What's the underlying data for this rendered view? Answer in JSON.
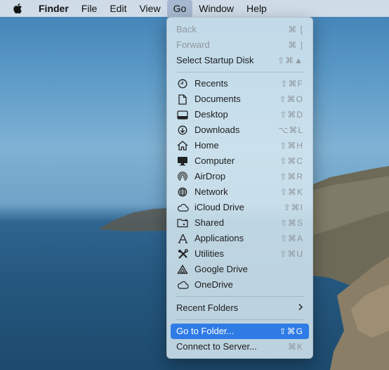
{
  "menubar": {
    "apple_icon": "apple-logo-icon",
    "items": [
      {
        "label": "Finder",
        "bold": true
      },
      {
        "label": "File"
      },
      {
        "label": "Edit"
      },
      {
        "label": "View"
      },
      {
        "label": "Go",
        "active": true
      },
      {
        "label": "Window"
      },
      {
        "label": "Help"
      }
    ]
  },
  "go_menu": {
    "section1": [
      {
        "label": "Back",
        "shortcut": "⌘ [",
        "disabled": true
      },
      {
        "label": "Forward",
        "shortcut": "⌘ ]",
        "disabled": true
      },
      {
        "label": "Select Startup Disk",
        "shortcut": "⇧⌘▲"
      }
    ],
    "section2": [
      {
        "label": "Recents",
        "shortcut": "⇧⌘F",
        "icon": "clock-icon"
      },
      {
        "label": "Documents",
        "shortcut": "⇧⌘O",
        "icon": "document-icon"
      },
      {
        "label": "Desktop",
        "shortcut": "⇧⌘D",
        "icon": "desktop-icon"
      },
      {
        "label": "Downloads",
        "shortcut": "⌥⌘L",
        "icon": "download-icon"
      },
      {
        "label": "Home",
        "shortcut": "⇧⌘H",
        "icon": "home-icon"
      },
      {
        "label": "Computer",
        "shortcut": "⇧⌘C",
        "icon": "computer-icon"
      },
      {
        "label": "AirDrop",
        "shortcut": "⇧⌘R",
        "icon": "airdrop-icon"
      },
      {
        "label": "Network",
        "shortcut": "⇧⌘K",
        "icon": "network-globe-icon"
      },
      {
        "label": "iCloud Drive",
        "shortcut": "⇧⌘I",
        "icon": "cloud-icon"
      },
      {
        "label": "Shared",
        "shortcut": "⇧⌘S",
        "icon": "shared-folder-icon"
      },
      {
        "label": "Applications",
        "shortcut": "⇧⌘A",
        "icon": "applications-icon"
      },
      {
        "label": "Utilities",
        "shortcut": "⇧⌘U",
        "icon": "utilities-tools-icon"
      },
      {
        "label": "Google Drive",
        "shortcut": "",
        "icon": "google-drive-icon"
      },
      {
        "label": "OneDrive",
        "shortcut": "",
        "icon": "cloud-icon"
      }
    ],
    "section3": [
      {
        "label": "Recent Folders",
        "submenu_icon": "chevron-right-icon"
      }
    ],
    "section4": [
      {
        "label": "Go to Folder...",
        "shortcut": "⇧⌘G",
        "selected": true
      },
      {
        "label": "Connect to Server...",
        "shortcut": "⌘K"
      }
    ]
  }
}
